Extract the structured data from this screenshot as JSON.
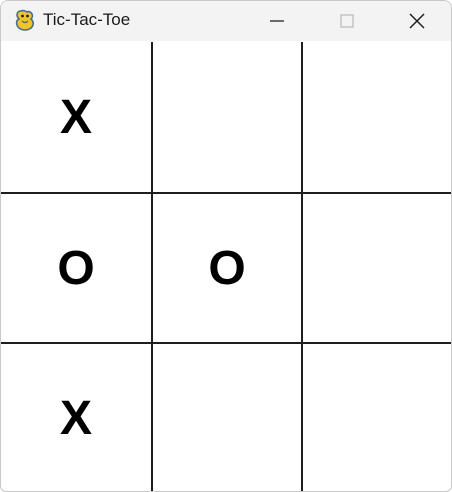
{
  "window": {
    "title": "Tic-Tac-Toe",
    "app_icon": "python-snake-icon",
    "controls": {
      "minimize": "minimize-icon",
      "maximize": "maximize-icon",
      "close": "close-icon"
    }
  },
  "board": {
    "rows": [
      [
        "X",
        "",
        ""
      ],
      [
        "O",
        "O",
        ""
      ],
      [
        "X",
        "",
        ""
      ]
    ],
    "line_color": "#1e1e1e",
    "mark_color": "#000000",
    "background": "#ffffff"
  }
}
